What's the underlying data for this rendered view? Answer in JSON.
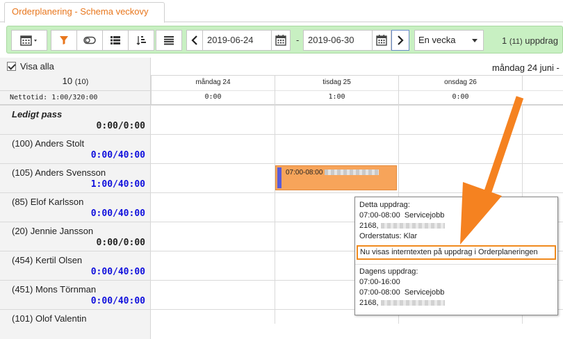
{
  "tab": {
    "title": "Orderplanering - Schema veckovy"
  },
  "toolbar": {
    "date_from": "2019-06-24",
    "date_to": "2019-06-30",
    "separator": "-",
    "period": "En vecka",
    "status_count": "1",
    "status_total": "(11)",
    "status_text": "uppdrag"
  },
  "left": {
    "show_all": "Visa alla",
    "count": "10",
    "count_total": "(10)",
    "netto": "Nettotid: 1:00/320:00"
  },
  "week_title": "måndag 24 juni -",
  "days": [
    {
      "name": "måndag 24",
      "total": "0:00"
    },
    {
      "name": "tisdag 25",
      "total": "1:00"
    },
    {
      "name": "onsdag 26",
      "total": "0:00"
    }
  ],
  "rows": [
    {
      "name": "Ledigt pass",
      "time": "0:00/0:00",
      "time_color": "black",
      "italic": true
    },
    {
      "name": "(100) Anders Stolt",
      "time": "0:00/40:00",
      "time_color": "blue"
    },
    {
      "name": "(105) Anders Svensson",
      "time": "1:00/40:00",
      "time_color": "blue"
    },
    {
      "name": "(85) Elof Karlsson",
      "time": "0:00/40:00",
      "time_color": "blue"
    },
    {
      "name": "(20) Jennie Jansson",
      "time": "0:00/0:00",
      "time_color": "black"
    },
    {
      "name": "(454) Kertil Olsen",
      "time": "0:00/40:00",
      "time_color": "blue"
    },
    {
      "name": "(451) Mons Törnman",
      "time": "0:00/40:00",
      "time_color": "blue"
    },
    {
      "name": "(101) Olof Valentin",
      "time": "",
      "time_color": "blue"
    }
  ],
  "job": {
    "time": "07:00-08:00"
  },
  "tooltip": {
    "this_heading": "Detta uppdrag:",
    "this_line": "07:00-08:00  Servicejobb",
    "this_customer": "2168,",
    "order_status": "Orderstatus: Klar",
    "highlight": "Nu visas interntexten på uppdrag i Orderplaneringen",
    "day_heading": "Dagens uppdrag:",
    "day_range": "07:00-16:00",
    "day_line": "07:00-08:00  Servicejobb",
    "day_customer": "2168,"
  },
  "colors": {
    "accent": "#e8761c",
    "toolbar_bg": "#c8f0c2",
    "job_bg": "#f7a45a",
    "blue": "#1010dd",
    "arrow": "#f58220"
  }
}
